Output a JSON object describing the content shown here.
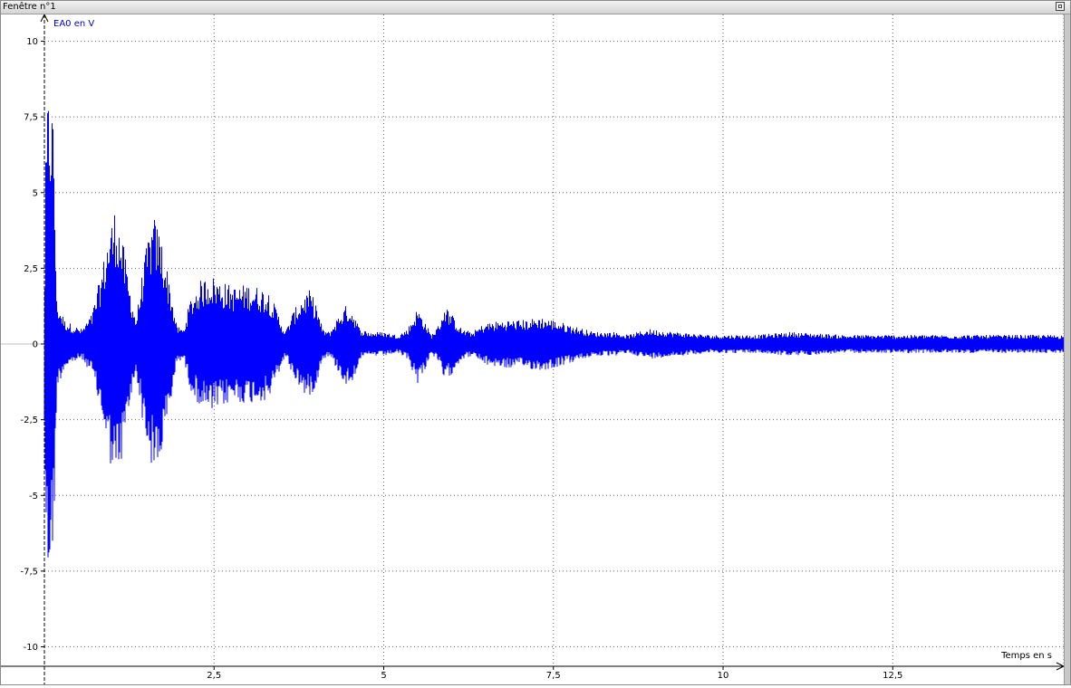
{
  "window": {
    "title": "Fenêtre n°1"
  },
  "colors": {
    "signal": "#0000ff",
    "grid": "#666666",
    "axis": "#000000",
    "ylabel_color": "#0000cc"
  },
  "chart_data": {
    "type": "line",
    "ylabel": "EA0 en V",
    "xlabel": "Temps en s",
    "xlim": [
      0,
      15.1
    ],
    "ylim": [
      -10.8,
      11.3
    ],
    "x_ticks": [
      {
        "value": 2.5,
        "label": "2,5"
      },
      {
        "value": 5,
        "label": "5"
      },
      {
        "value": 7.5,
        "label": "7,5"
      },
      {
        "value": 10,
        "label": "10"
      },
      {
        "value": 12.5,
        "label": "12,5"
      }
    ],
    "y_ticks": [
      {
        "value": 10,
        "label": "10"
      },
      {
        "value": 7.5,
        "label": "7,5"
      },
      {
        "value": 5,
        "label": "5"
      },
      {
        "value": 2.5,
        "label": "2,5"
      },
      {
        "value": 0,
        "label": "0"
      },
      {
        "value": -2.5,
        "label": "-2,5"
      },
      {
        "value": -5,
        "label": "-5"
      },
      {
        "value": -7.5,
        "label": "-7,5"
      },
      {
        "value": -10,
        "label": "-10"
      }
    ],
    "grid": true,
    "series": [
      {
        "envelope": [
          [
            0.0,
            1.0,
            -3.0
          ],
          [
            0.02,
            6.0,
            -6.0
          ],
          [
            0.05,
            8.3,
            -8.2
          ],
          [
            0.1,
            8.5,
            -7.0
          ],
          [
            0.14,
            7.2,
            -6.8
          ],
          [
            0.18,
            1.5,
            -1.5
          ],
          [
            0.3,
            0.8,
            -0.8
          ],
          [
            0.45,
            0.6,
            -0.6
          ],
          [
            0.55,
            0.5,
            -0.5
          ],
          [
            0.7,
            1.0,
            -1.0
          ],
          [
            0.85,
            2.5,
            -2.5
          ],
          [
            0.95,
            3.8,
            -3.8
          ],
          [
            1.05,
            4.6,
            -4.6
          ],
          [
            1.15,
            3.5,
            -3.8
          ],
          [
            1.25,
            2.0,
            -2.2
          ],
          [
            1.35,
            0.8,
            -0.9
          ],
          [
            1.45,
            2.5,
            -2.6
          ],
          [
            1.55,
            3.8,
            -3.9
          ],
          [
            1.62,
            4.2,
            -4.4
          ],
          [
            1.72,
            3.6,
            -3.8
          ],
          [
            1.85,
            2.0,
            -2.2
          ],
          [
            1.95,
            0.6,
            -0.6
          ],
          [
            2.05,
            0.5,
            -0.5
          ],
          [
            2.15,
            1.5,
            -1.5
          ],
          [
            2.3,
            2.1,
            -2.1
          ],
          [
            2.45,
            2.3,
            -2.3
          ],
          [
            2.6,
            2.1,
            -2.1
          ],
          [
            2.8,
            1.9,
            -1.9
          ],
          [
            3.0,
            2.0,
            -2.0
          ],
          [
            3.15,
            1.9,
            -1.9
          ],
          [
            3.3,
            1.8,
            -1.9
          ],
          [
            3.45,
            1.0,
            -1.0
          ],
          [
            3.55,
            0.4,
            -0.4
          ],
          [
            3.65,
            1.0,
            -1.0
          ],
          [
            3.8,
            1.6,
            -1.6
          ],
          [
            3.9,
            1.8,
            -1.8
          ],
          [
            4.0,
            1.4,
            -1.4
          ],
          [
            4.1,
            0.5,
            -0.5
          ],
          [
            4.2,
            0.4,
            -0.4
          ],
          [
            4.35,
            1.0,
            -1.0
          ],
          [
            4.45,
            1.3,
            -1.4
          ],
          [
            4.55,
            1.1,
            -1.2
          ],
          [
            4.65,
            0.5,
            -0.5
          ],
          [
            4.8,
            0.4,
            -0.4
          ],
          [
            5.0,
            0.4,
            -0.4
          ],
          [
            5.2,
            0.3,
            -0.3
          ],
          [
            5.35,
            0.5,
            -0.5
          ],
          [
            5.5,
            1.2,
            -1.3
          ],
          [
            5.6,
            0.8,
            -0.9
          ],
          [
            5.7,
            0.3,
            -0.3
          ],
          [
            5.8,
            0.6,
            -0.6
          ],
          [
            5.9,
            1.3,
            -1.3
          ],
          [
            6.0,
            1.0,
            -1.0
          ],
          [
            6.15,
            0.5,
            -0.5
          ],
          [
            6.3,
            0.4,
            -0.4
          ],
          [
            6.5,
            0.7,
            -0.7
          ],
          [
            6.8,
            0.8,
            -0.8
          ],
          [
            7.1,
            0.8,
            -0.8
          ],
          [
            7.3,
            0.9,
            -0.9
          ],
          [
            7.5,
            0.8,
            -0.8
          ],
          [
            7.8,
            0.6,
            -0.6
          ],
          [
            8.1,
            0.4,
            -0.4
          ],
          [
            8.4,
            0.4,
            -0.4
          ],
          [
            8.6,
            0.3,
            -0.3
          ],
          [
            8.9,
            0.5,
            -0.5
          ],
          [
            9.3,
            0.4,
            -0.4
          ],
          [
            9.8,
            0.3,
            -0.3
          ],
          [
            10.5,
            0.3,
            -0.3
          ],
          [
            11.0,
            0.4,
            -0.4
          ],
          [
            11.8,
            0.3,
            -0.3
          ],
          [
            12.5,
            0.3,
            -0.3
          ],
          [
            13.5,
            0.3,
            -0.3
          ],
          [
            14.5,
            0.3,
            -0.3
          ],
          [
            15.1,
            0.3,
            -0.3
          ]
        ]
      }
    ]
  }
}
